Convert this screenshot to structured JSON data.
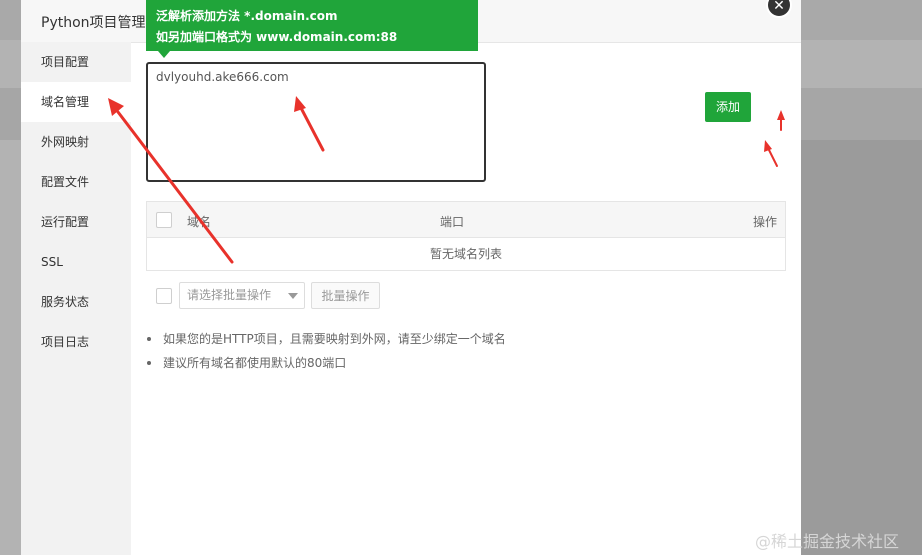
{
  "modal": {
    "title": "Python项目管理",
    "title_tail": "]",
    "close_symbol": "✕"
  },
  "sidebar": {
    "items": [
      {
        "label": "项目配置"
      },
      {
        "label": "域名管理"
      },
      {
        "label": "外网映射"
      },
      {
        "label": "配置文件"
      },
      {
        "label": "运行配置"
      },
      {
        "label": "SSL"
      },
      {
        "label": "服务状态"
      },
      {
        "label": "项目日志"
      }
    ],
    "active_index": 1
  },
  "tooltip": {
    "line1": "泛解析添加方法 *.domain.com",
    "line2": "如另加端口格式为 www.domain.com:88"
  },
  "domain_input": {
    "value": "dvlyouhd.ake666.com"
  },
  "add_button": {
    "label": "添加"
  },
  "table": {
    "columns": [
      "域名",
      "端口",
      "操作"
    ],
    "empty_text": "暂无域名列表"
  },
  "batch": {
    "select_placeholder": "请选择批量操作",
    "button_label": "批量操作"
  },
  "tips": [
    "如果您的是HTTP项目，且需要映射到外网，请至少绑定一个域名",
    "建议所有域名都使用默认的80端口"
  ],
  "watermark": "@稀土掘金技术社区",
  "colors": {
    "accent_green": "#20a53a",
    "arrow_red": "#e8322b"
  }
}
